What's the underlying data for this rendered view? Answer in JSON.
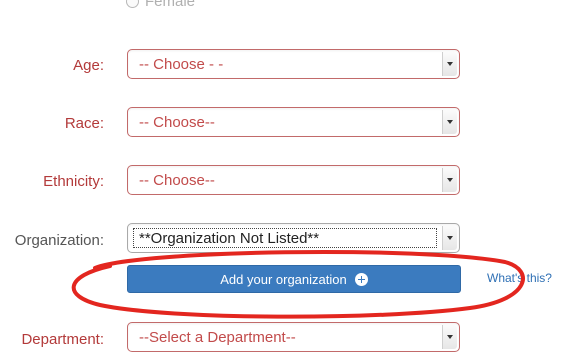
{
  "gender": {
    "option_label": "Female"
  },
  "fields": {
    "age": {
      "label": "Age:",
      "value": "-- Choose - -"
    },
    "race": {
      "label": "Race:",
      "value": "-- Choose--"
    },
    "ethnicity": {
      "label": "Ethnicity:",
      "value": "-- Choose--"
    },
    "organization": {
      "label": "Organization:",
      "value": "**Organization Not Listed**"
    },
    "department": {
      "label": "Department:",
      "value": "--Select a Department--"
    }
  },
  "add_organization": {
    "label": "Add your organization",
    "icon": "plus-circle-icon"
  },
  "help_link": {
    "label": "What's this?"
  },
  "colors": {
    "label_red": "#b33a3a",
    "button_blue": "#3b7bbf",
    "annotation_red": "#e3261f",
    "link_blue": "#2f70b5"
  }
}
